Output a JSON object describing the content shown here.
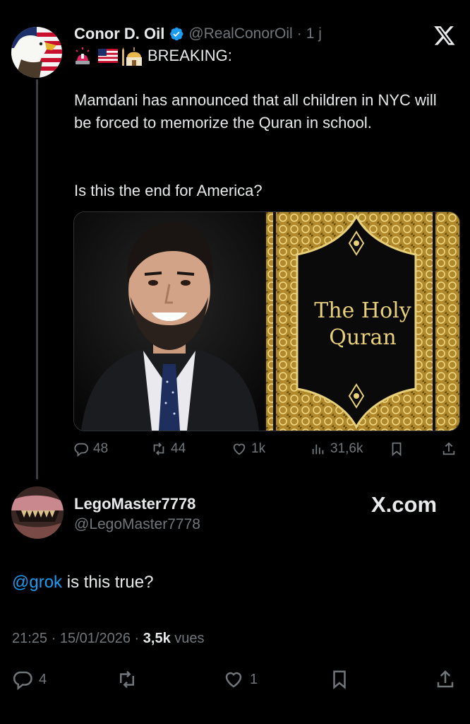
{
  "tweet": {
    "author_name": "Conor D. Oil",
    "handle": "@RealConorOil",
    "separator": "·",
    "time_ago": "1 j",
    "breaking_line": "BREAKING:",
    "text_p1": "Mamdani has announced that all children in NYC will be forced to memorize the Quran in school.",
    "text_p2": "Is this the end for America?",
    "book_title_line1": "The Holy",
    "book_title_line2": "Quran",
    "stats": {
      "replies": "48",
      "reposts": "44",
      "likes": "1k",
      "views": "31,6k"
    }
  },
  "reply": {
    "author_name": "LegoMaster7778",
    "handle": "@LegoMaster7778",
    "watermark": "X.com",
    "mention": "@grok",
    "text": " is this true?",
    "time": "21:25",
    "sep1": "·",
    "date": "15/01/2026",
    "sep2": "·",
    "views_count": "3,5k",
    "views_label": "vues",
    "stats": {
      "replies": "4",
      "likes": "1"
    }
  },
  "colors": {
    "background": "#000000",
    "text": "#e7e9ea",
    "muted": "#71767b",
    "link": "#1d9bf0",
    "verified": "#1d9bf0",
    "book_gold": "#c9a43b"
  }
}
